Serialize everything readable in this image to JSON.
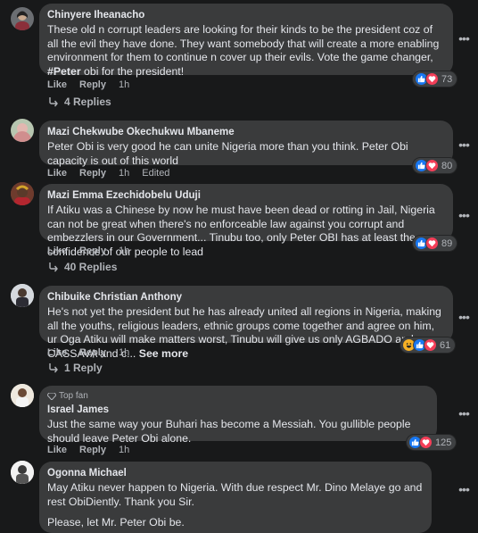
{
  "comments": [
    {
      "author": "Chinyere Iheanacho",
      "text_pre": "These old n corrupt leaders are looking for their kinds to be the president coz of all the evil they have done. They want somebody that will create a more enabling environment for them to continue n cover up their evils. Vote the game changer, ",
      "text_bold": "#Peter",
      "text_post": " obi for the president!",
      "like": "Like",
      "reply": "Reply",
      "time": "1h",
      "reactions": "73",
      "replies": "4 Replies"
    },
    {
      "author": "Mazi Chekwube Okechukwu Mbaneme",
      "text": "Peter Obi is very good he can unite Nigeria more than you think. Peter Obi capacity is out of this world",
      "like": "Like",
      "reply": "Reply",
      "time": "1h",
      "edited": "Edited",
      "reactions": "80"
    },
    {
      "author": "Mazi Emma Ezechidobelu Uduji",
      "text": "If Atiku was a Chinese by now he must have been dead or rotting in Jail, Nigeria can not be great when there's no enforceable law against you corrupt and embezzlers in our Government... Tinubu too, only Peter OBI has at least the confidence of our people to lead",
      "like": "Like",
      "reply": "Reply",
      "time": "1h",
      "reactions": "89",
      "replies": "40 Replies"
    },
    {
      "author": "Chibuike Christian Anthony",
      "text": "He's not yet the president but he has already united all regions in Nigeria, making all the youths, religious leaders, ethnic groups come together and agree on him, ur Oga Atiku will make matters worst, Tinubu will give us only AGBADO and CASSAVA and c...",
      "see_more": "See more",
      "like": "Like",
      "reply": "Reply",
      "time": "1h",
      "reactions": "61",
      "replies": "1 Reply"
    },
    {
      "badge": "Top fan",
      "author": "Israel James",
      "text": "Just the same way your Buhari has become a Messiah. You gullible people should leave Peter Obi alone.",
      "like": "Like",
      "reply": "Reply",
      "time": "1h",
      "reactions": "125"
    },
    {
      "author": "Ogonna Michael",
      "text": "May Atiku never happen to Nigeria. With due respect Mr. Dino Melaye go and rest ObiDiently. Thank you Sir.",
      "text2": "Please, let Mr. Peter Obi be."
    }
  ],
  "colors": {
    "bg": "#18191a",
    "bubble": "#3a3b3c",
    "like": "#1877f2",
    "love": "#f33e58",
    "haha": "#f7b125"
  }
}
